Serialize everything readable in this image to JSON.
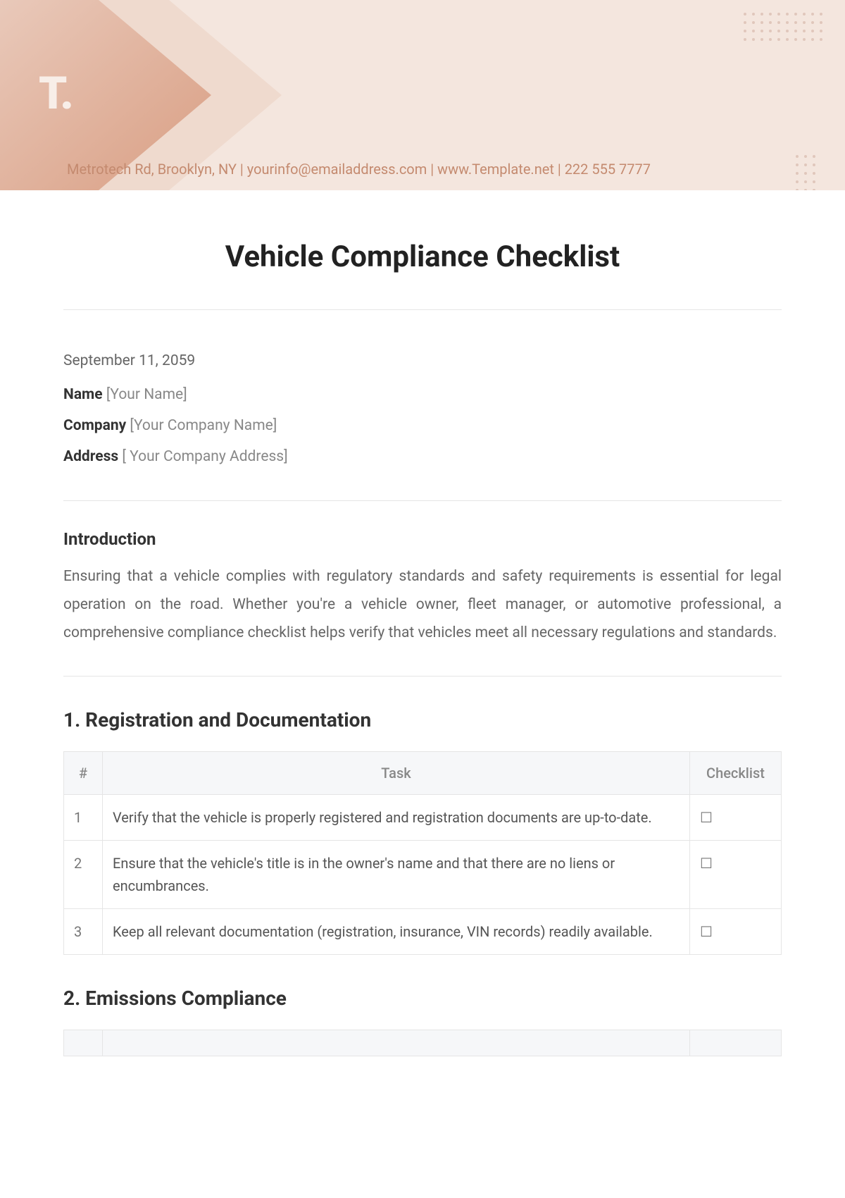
{
  "header": {
    "logo_text": "T.",
    "contact_line": "Metrotech Rd, Brooklyn, NY  |  yourinfo@emailaddress.com  |  www.Template.net  |  222 555 7777"
  },
  "title": "Vehicle Compliance Checklist",
  "meta": {
    "date": "September 11, 2059",
    "name_label": "Name",
    "name_placeholder": "[Your Name]",
    "company_label": "Company",
    "company_placeholder": "[Your Company Name]",
    "address_label": "Address",
    "address_placeholder": "[ Your Company Address]"
  },
  "intro": {
    "heading": "Introduction",
    "body": "Ensuring that a vehicle complies with regulatory standards and safety requirements is essential for legal operation on the road. Whether you're a vehicle owner, fleet manager, or automotive professional, a comprehensive compliance checklist helps verify that vehicles meet all necessary regulations and standards."
  },
  "columns": {
    "num": "#",
    "task": "Task",
    "checklist": "Checklist"
  },
  "section1": {
    "title": "1. Registration and Documentation",
    "rows": [
      {
        "n": "1",
        "task": "Verify that the vehicle is properly registered and registration documents are up-to-date.",
        "box": "☐"
      },
      {
        "n": "2",
        "task": "Ensure that the vehicle's title is in the owner's name and that there are no liens or encumbrances.",
        "box": "☐"
      },
      {
        "n": "3",
        "task": "Keep all relevant documentation (registration, insurance, VIN records) readily available.",
        "box": "☐"
      }
    ]
  },
  "section2": {
    "title": "2. Emissions Compliance"
  }
}
